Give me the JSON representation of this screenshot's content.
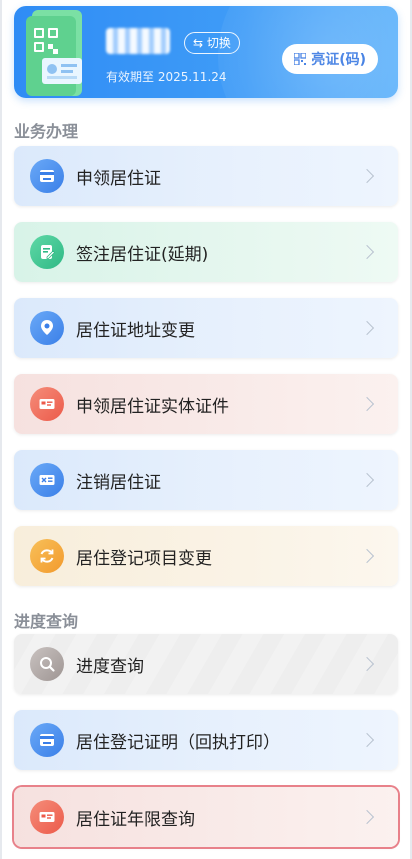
{
  "card": {
    "switch_label": "⇆ 切换",
    "valid_text": "有效期至 2025.11.24",
    "show_code_label": "亮证(码)"
  },
  "sections": {
    "business": "业务办理",
    "progress": "进度查询"
  },
  "business_items": [
    {
      "label": "申领居住证",
      "icon": "id-card-icon",
      "color": "blue"
    },
    {
      "label": "签注居住证(延期)",
      "icon": "edit-document-icon",
      "color": "green"
    },
    {
      "label": "居住证地址变更",
      "icon": "location-pin-icon",
      "color": "blue"
    },
    {
      "label": "申领居住证实体证件",
      "icon": "physical-card-icon",
      "color": "red"
    },
    {
      "label": "注销居住证",
      "icon": "cancel-card-icon",
      "color": "blue"
    },
    {
      "label": "居住登记项目变更",
      "icon": "refresh-icon",
      "color": "yellow"
    }
  ],
  "progress_items": [
    {
      "label": "进度查询",
      "icon": "search-icon",
      "color": "gray"
    },
    {
      "label": "居住登记证明（回执打印）",
      "icon": "certificate-icon",
      "color": "blue"
    },
    {
      "label": "居住证年限查询",
      "icon": "card-query-icon",
      "color": "red",
      "selected": true
    }
  ],
  "colors": {
    "card_blue": "#2f8cf5",
    "selected_outline": "#e8818a",
    "section_title": "#8a8f98"
  }
}
